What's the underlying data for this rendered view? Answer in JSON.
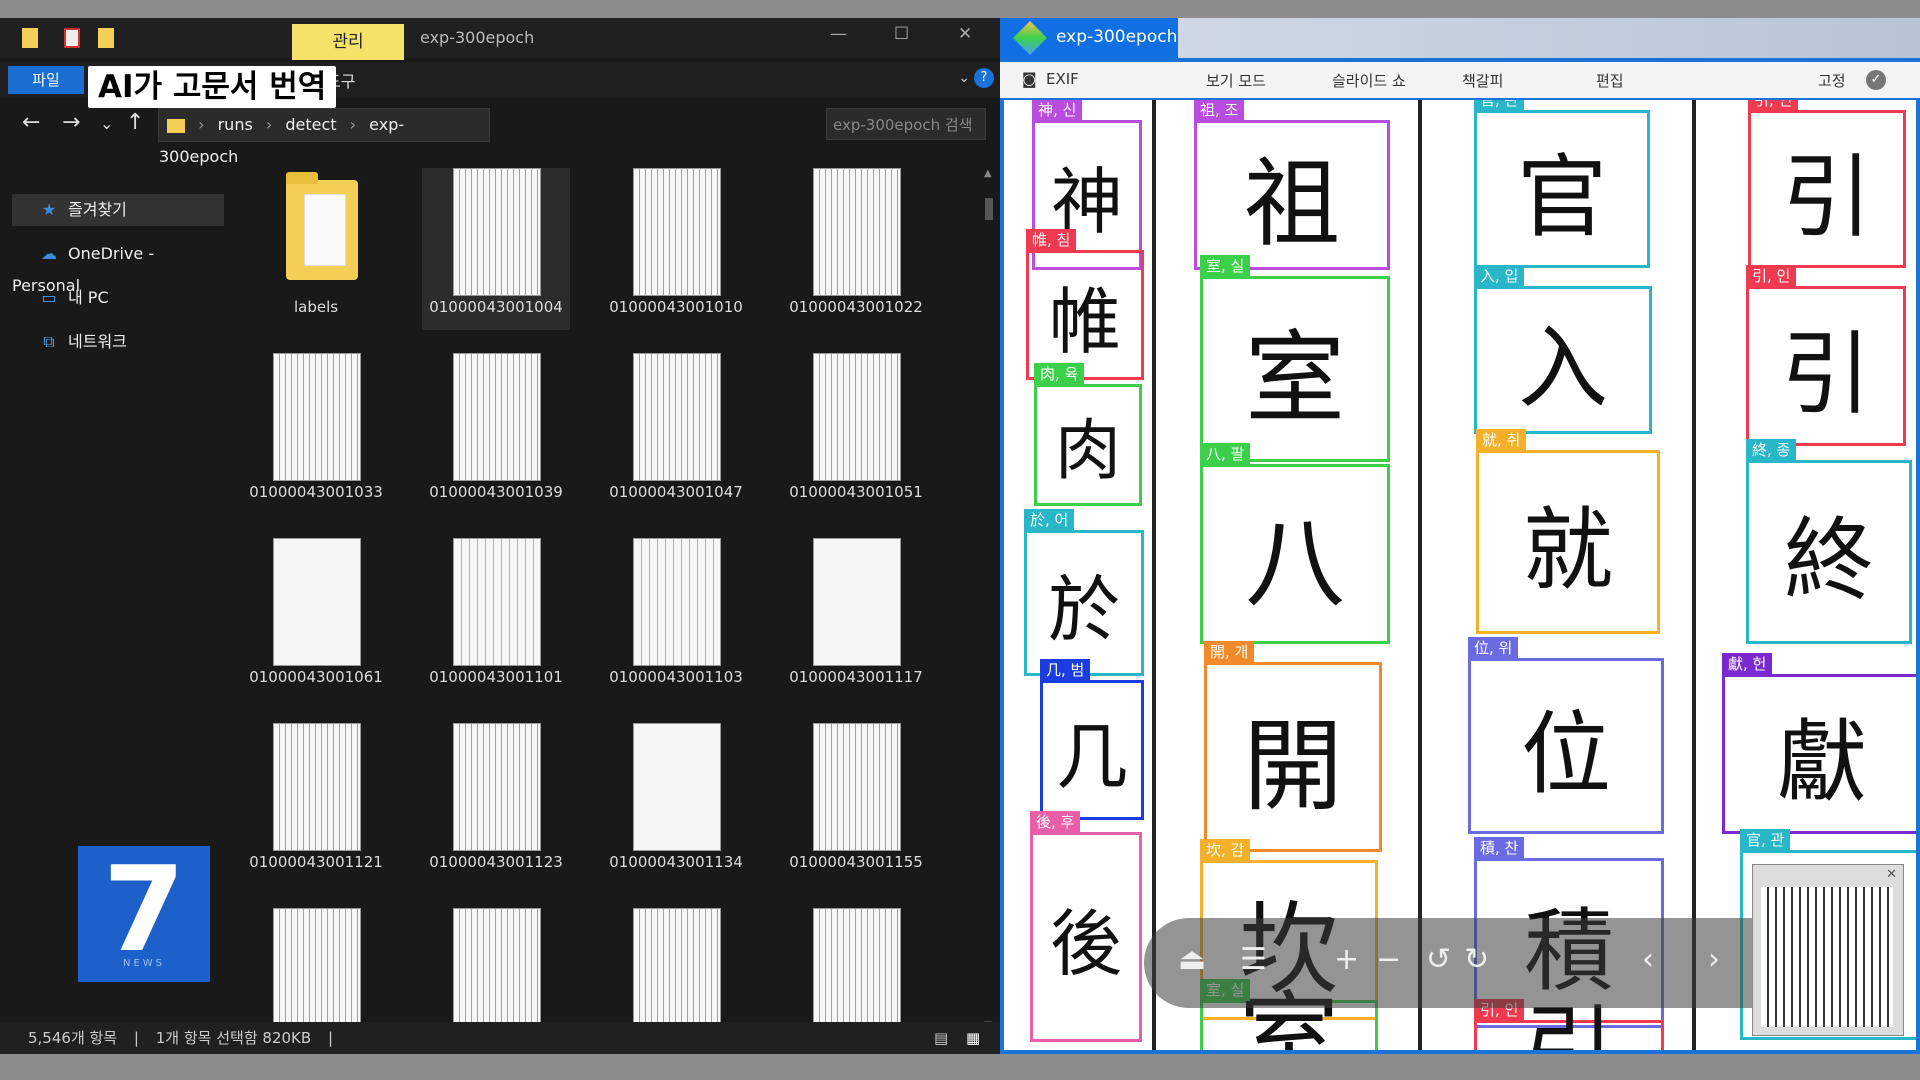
{
  "overlay": {
    "headline": "AI가 고문서 번역",
    "channel_number": "7",
    "channel_sub": "NEWS"
  },
  "explorer": {
    "ribbon_context_tab": "관리",
    "window_title": "exp-300epoch",
    "file_tab": "파일",
    "ribbon_tool": "도구",
    "address": [
      "runs",
      "detect",
      "exp-300epoch"
    ],
    "search_placeholder": "exp-300epoch 검색",
    "sidebar": [
      {
        "label": "즐겨찾기",
        "icon": "star-icon"
      },
      {
        "label": "OneDrive - Personal",
        "icon": "cloud-icon"
      },
      {
        "label": "내 PC",
        "icon": "pc-icon"
      },
      {
        "label": "네트워크",
        "icon": "network-icon"
      }
    ],
    "items": [
      {
        "name": "labels",
        "kind": "folder"
      },
      {
        "name": "01000043001004",
        "kind": "image",
        "selected": true
      },
      {
        "name": "01000043001010",
        "kind": "image"
      },
      {
        "name": "01000043001022",
        "kind": "image"
      },
      {
        "name": "01000043001033",
        "kind": "image"
      },
      {
        "name": "01000043001039",
        "kind": "image"
      },
      {
        "name": "01000043001047",
        "kind": "image"
      },
      {
        "name": "01000043001051",
        "kind": "image"
      },
      {
        "name": "01000043001061",
        "kind": "sparse"
      },
      {
        "name": "01000043001101",
        "kind": "mixed"
      },
      {
        "name": "01000043001103",
        "kind": "mixed"
      },
      {
        "name": "01000043001117",
        "kind": "sparse"
      },
      {
        "name": "01000043001121",
        "kind": "image"
      },
      {
        "name": "01000043001123",
        "kind": "image"
      },
      {
        "name": "01000043001134",
        "kind": "sparse"
      },
      {
        "name": "01000043001155",
        "kind": "image"
      },
      {
        "name": "",
        "kind": "image"
      },
      {
        "name": "",
        "kind": "image"
      },
      {
        "name": "",
        "kind": "image"
      },
      {
        "name": "",
        "kind": "image"
      }
    ],
    "status_count": "5,546개 항목",
    "status_selected": "1개 항목 선택함 820KB"
  },
  "viewer": {
    "title": "exp-300epoch",
    "toolbar": [
      "EXIF",
      "보기 모드",
      "슬라이드 쇼",
      "책갈피",
      "편집",
      "고정"
    ],
    "detections": [
      {
        "char": "神",
        "label": "神, 신",
        "color": "#b84de0"
      },
      {
        "char": "帷",
        "label": "帷, 침",
        "color": "#ef3a4f"
      },
      {
        "char": "肉",
        "label": "肉, 육",
        "color": "#3cd04a"
      },
      {
        "char": "於",
        "label": "於, 어",
        "color": "#2ab6c9"
      },
      {
        "char": "几",
        "label": "几, 범",
        "color": "#1a3de0"
      },
      {
        "char": "後",
        "label": "後, 후",
        "color": "#e85fa8"
      },
      {
        "char": "祖",
        "label": "祖, 조",
        "color": "#b84de0"
      },
      {
        "char": "室",
        "label": "室, 실",
        "color": "#3cd04a"
      },
      {
        "char": "八",
        "label": "八, 팔",
        "color": "#3cd04a"
      },
      {
        "char": "開",
        "label": "開, 개",
        "color": "#f08a2a"
      },
      {
        "char": "坎",
        "label": "坎, 감",
        "color": "#f4b02a"
      },
      {
        "char": "室",
        "label": "室, 실",
        "color": "#3cd04a"
      },
      {
        "char": "官",
        "label": "官, 관",
        "color": "#2ab6c9"
      },
      {
        "char": "入",
        "label": "入, 입",
        "color": "#2ab6c9"
      },
      {
        "char": "就",
        "label": "就, 취",
        "color": "#f4b02a"
      },
      {
        "char": "位",
        "label": "位, 위",
        "color": "#6a6be0"
      },
      {
        "char": "積",
        "label": "積, 찬",
        "color": "#6a6be0"
      },
      {
        "char": "引",
        "label": "引, 인",
        "color": "#ef3a4f"
      },
      {
        "char": "引",
        "label": "引, 인",
        "color": "#ef3a4f"
      },
      {
        "char": "引",
        "label": "引, 인",
        "color": "#ef3a4f"
      },
      {
        "char": "終",
        "label": "終, 종",
        "color": "#2ab6c9"
      },
      {
        "char": "獻",
        "label": "獻, 헌",
        "color": "#7a2ad0"
      },
      {
        "char": "官",
        "label": "官, 관",
        "color": "#2ab6c9"
      }
    ]
  }
}
